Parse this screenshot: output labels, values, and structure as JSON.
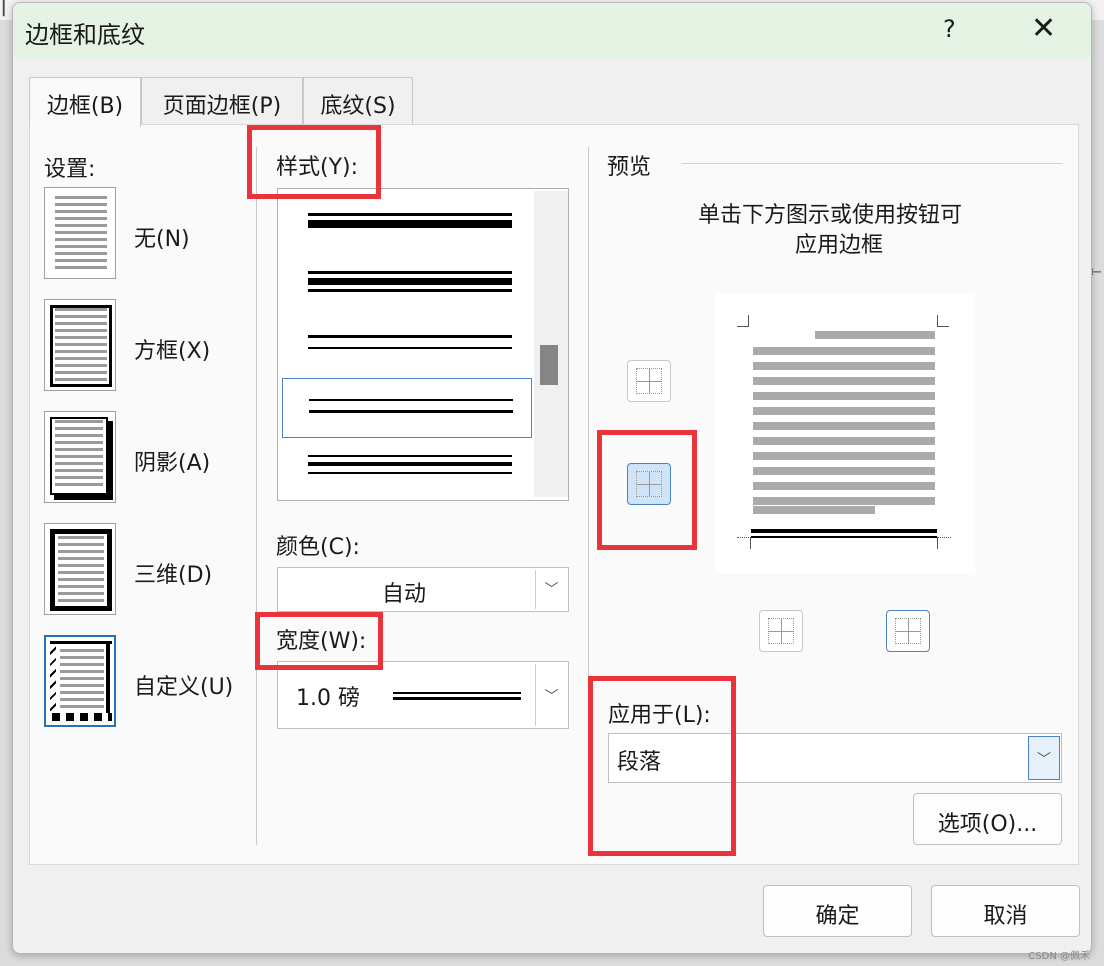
{
  "dialog": {
    "title": "边框和底纹",
    "help": "?",
    "close": "✕"
  },
  "tabs": [
    {
      "label": "边框(B)",
      "active": true
    },
    {
      "label": "页面边框(P)",
      "active": false
    },
    {
      "label": "底纹(S)",
      "active": false
    }
  ],
  "settings": {
    "label": "设置:",
    "items": [
      {
        "label": "无(N)",
        "icon": "none-setting-icon"
      },
      {
        "label": "方框(X)",
        "icon": "box-setting-icon"
      },
      {
        "label": "阴影(A)",
        "icon": "shadow-setting-icon"
      },
      {
        "label": "三维(D)",
        "icon": "3d-setting-icon"
      },
      {
        "label": "自定义(U)",
        "icon": "custom-setting-icon",
        "selected": true
      }
    ]
  },
  "style": {
    "label": "样式(Y):"
  },
  "color": {
    "label": "颜色(C):",
    "value": "自动"
  },
  "width": {
    "label": "宽度(W):",
    "value": "1.0 磅"
  },
  "preview": {
    "label": "预览",
    "instructions_line1": "单击下方图示或使用按钮可",
    "instructions_line2": "应用边框"
  },
  "apply_to": {
    "label": "应用于(L):",
    "value": "段落"
  },
  "buttons": {
    "options": "选项(O)...",
    "ok": "确定",
    "cancel": "取消"
  },
  "watermark": "CSDN @佩禾",
  "colors": {
    "highlight": "#e8343a",
    "selection": "#2a6fb8",
    "titlebar": "#e4f3e4"
  }
}
